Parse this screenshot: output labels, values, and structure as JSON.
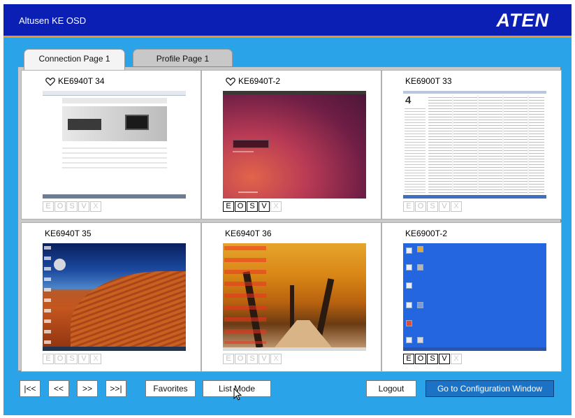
{
  "window": {
    "title": "Altusen KE OSD",
    "logo_text": "ATEN"
  },
  "tabs": [
    {
      "label": "Connection Page 1",
      "active": true
    },
    {
      "label": "Profile Page 1",
      "active": false
    }
  ],
  "tiles": [
    {
      "name": "KE6940T 34",
      "favorite": true,
      "thumbnail": "web-page",
      "buttons": [
        "E",
        "O",
        "S",
        "V",
        "X"
      ],
      "enabled": [
        false,
        false,
        false,
        false,
        false
      ]
    },
    {
      "name": "KE6940T-2",
      "favorite": true,
      "thumbnail": "ubuntu-login",
      "buttons": [
        "E",
        "O",
        "S",
        "V",
        "X"
      ],
      "enabled": [
        true,
        true,
        true,
        true,
        false
      ]
    },
    {
      "name": "KE6900T 33",
      "favorite": false,
      "thumbnail": "file-explorer",
      "buttons": [
        "E",
        "O",
        "S",
        "V",
        "X"
      ],
      "enabled": [
        false,
        false,
        false,
        false,
        false
      ]
    },
    {
      "name": "KE6940T 35",
      "favorite": false,
      "thumbnail": "desert-desktop",
      "buttons": [
        "E",
        "O",
        "S",
        "V",
        "X"
      ],
      "enabled": [
        false,
        false,
        false,
        false,
        false
      ]
    },
    {
      "name": "KE6940T 36",
      "favorite": false,
      "thumbnail": "autumn-desktop",
      "buttons": [
        "E",
        "O",
        "S",
        "V",
        "X"
      ],
      "enabled": [
        false,
        false,
        false,
        false,
        false
      ]
    },
    {
      "name": "KE6900T-2",
      "favorite": false,
      "thumbnail": "blue-desktop",
      "buttons": [
        "E",
        "O",
        "S",
        "V",
        "X"
      ],
      "enabled": [
        true,
        true,
        true,
        true,
        false
      ]
    }
  ],
  "toolbar": {
    "first_label": "|<<",
    "prev_label": "<<",
    "next_label": ">>",
    "last_label": ">>|",
    "favorites_label": "Favorites",
    "list_mode_label": "List Mode",
    "logout_label": "Logout",
    "config_label": "Go to Configuration Window"
  },
  "colors": {
    "header_bg": "#0c1fb4",
    "header_accent": "#e89a1d",
    "body_bg": "#2aa3e9",
    "config_button": "#1c73c6"
  }
}
